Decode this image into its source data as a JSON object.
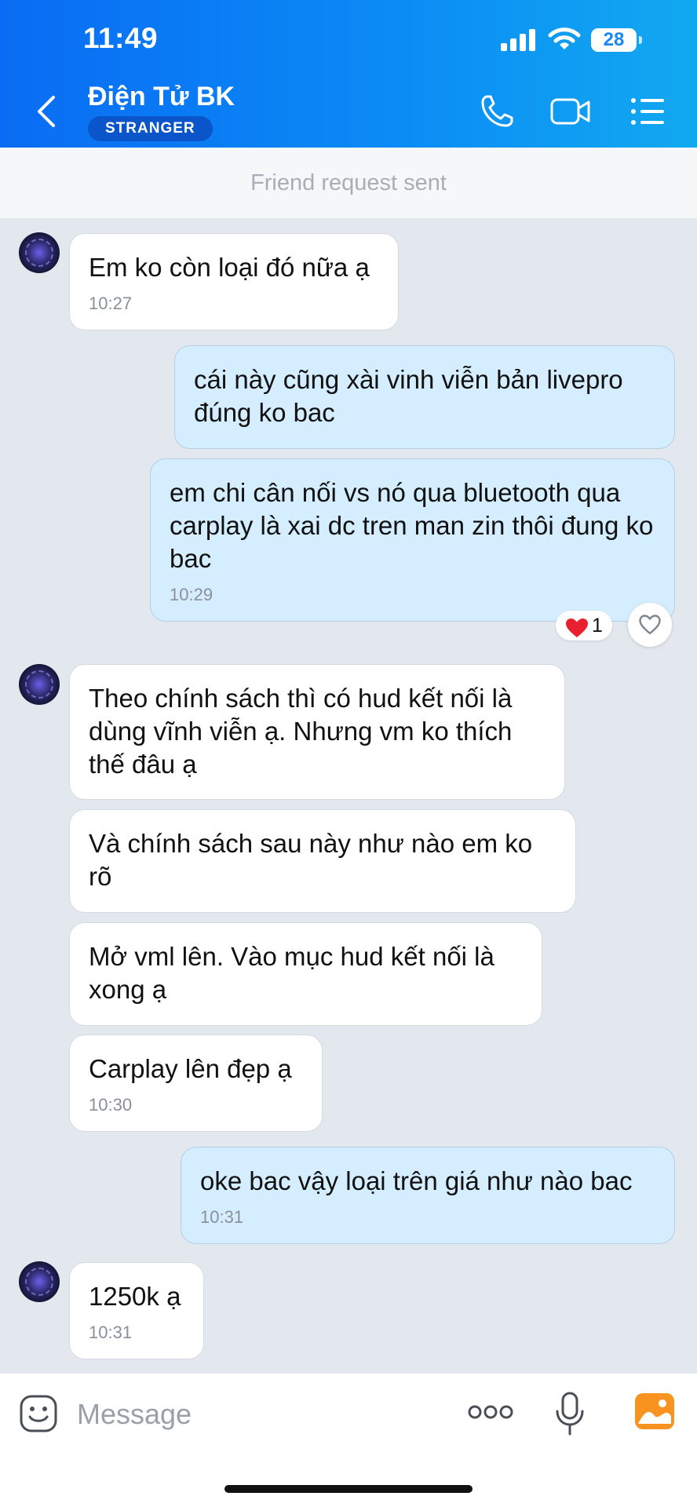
{
  "status_bar": {
    "time": "11:49",
    "battery": "28"
  },
  "header": {
    "contact_name": "Điện Tử BK",
    "badge": "STRANGER",
    "icons": [
      "back-icon",
      "phone-icon",
      "video-call-icon",
      "menu-list-icon"
    ]
  },
  "banner": {
    "text": "Friend request sent"
  },
  "messages": [
    {
      "direction": "in",
      "text": "Em ko còn loại đó nữa ạ",
      "time": "10:27"
    },
    {
      "direction": "out",
      "text": "cái này cũng xài vinh viễn bản livepro đúng ko bac",
      "time": ""
    },
    {
      "direction": "out",
      "text": "em chi cân nối vs nó qua bluetooth qua carplay là xai dc tren man zin thôi đung ko bac",
      "time": "10:29"
    },
    {
      "direction": "in",
      "text": "Theo chính sách thì có hud kết nối là dùng vĩnh viễn ạ. Nhưng vm ko thích thế đâu ạ",
      "time": ""
    },
    {
      "direction": "in",
      "text": "Và chính sách sau này như nào em ko rõ",
      "time": ""
    },
    {
      "direction": "in",
      "text": "Mở vml lên. Vào mục hud kết nối là xong ạ",
      "time": ""
    },
    {
      "direction": "in",
      "text": "Carplay lên đẹp ạ",
      "time": "10:30"
    },
    {
      "direction": "out",
      "text": "oke bac vậy loại trên giá như nào bac",
      "time": "10:31"
    },
    {
      "direction": "in",
      "text": "1250k ạ",
      "time": "10:31"
    }
  ],
  "reaction": {
    "emoji": "heart",
    "count": "1"
  },
  "composer": {
    "placeholder": "Message",
    "icons": [
      "sticker-icon",
      "more-options-icon",
      "microphone-icon",
      "image-gallery-icon"
    ]
  },
  "colors": {
    "header_start": "#0a6cf4",
    "header_end": "#12a9f0",
    "outgoing_bubble": "#d5eeff",
    "incoming_bubble": "#ffffff",
    "chat_background": "#e3e8ef",
    "gallery_icon": "#f7931e"
  }
}
